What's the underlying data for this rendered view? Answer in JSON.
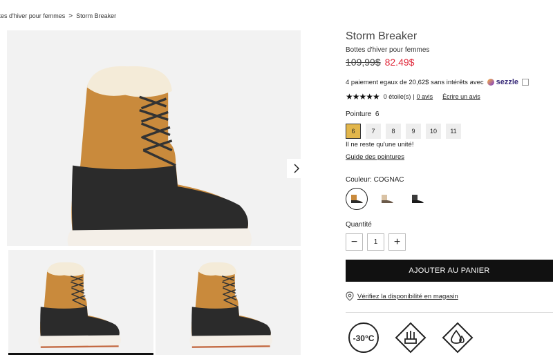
{
  "breadcrumb": {
    "parent": "ttes d'hiver pour femmes",
    "separator": ">",
    "current": "Storm Breaker"
  },
  "product": {
    "title": "Storm Breaker",
    "subtitle": "Bottes d'hiver pour femmes",
    "old_price": "109,99$",
    "new_price": "82.49$",
    "installments": "4 paiement egaux de 20,62$ sans intérêts avec",
    "sezzle_brand": "sezzle"
  },
  "rating": {
    "stars": "★★★★★",
    "score_text": "0 étoile(s)",
    "divider": "|",
    "reviews_link": "0 avis",
    "write_review": "Écrire un avis"
  },
  "size": {
    "label": "Pointure",
    "selected_value": "6",
    "options": [
      "6",
      "7",
      "8",
      "9",
      "10",
      "11"
    ],
    "stock_note": "Il ne reste qu'une unité!",
    "guide_link": "Guide des pointures"
  },
  "color": {
    "label": "Couleur: COGNAC",
    "options": [
      "cognac",
      "beige",
      "black"
    ],
    "accent_selected_size": "#e2b64b"
  },
  "quantity": {
    "label": "Quantité",
    "value": "1",
    "minus": "−",
    "plus": "+"
  },
  "cart": {
    "add_label": "AJOUTER AU PANIER"
  },
  "store": {
    "check_label": "Vérifiez la disponibilité en magasin"
  },
  "features": {
    "temp_rating": "-30°C"
  },
  "colors": {
    "sale_red": "#e0283a",
    "boot_tan": "#c98a3c",
    "boot_dark": "#2b2b2b"
  }
}
